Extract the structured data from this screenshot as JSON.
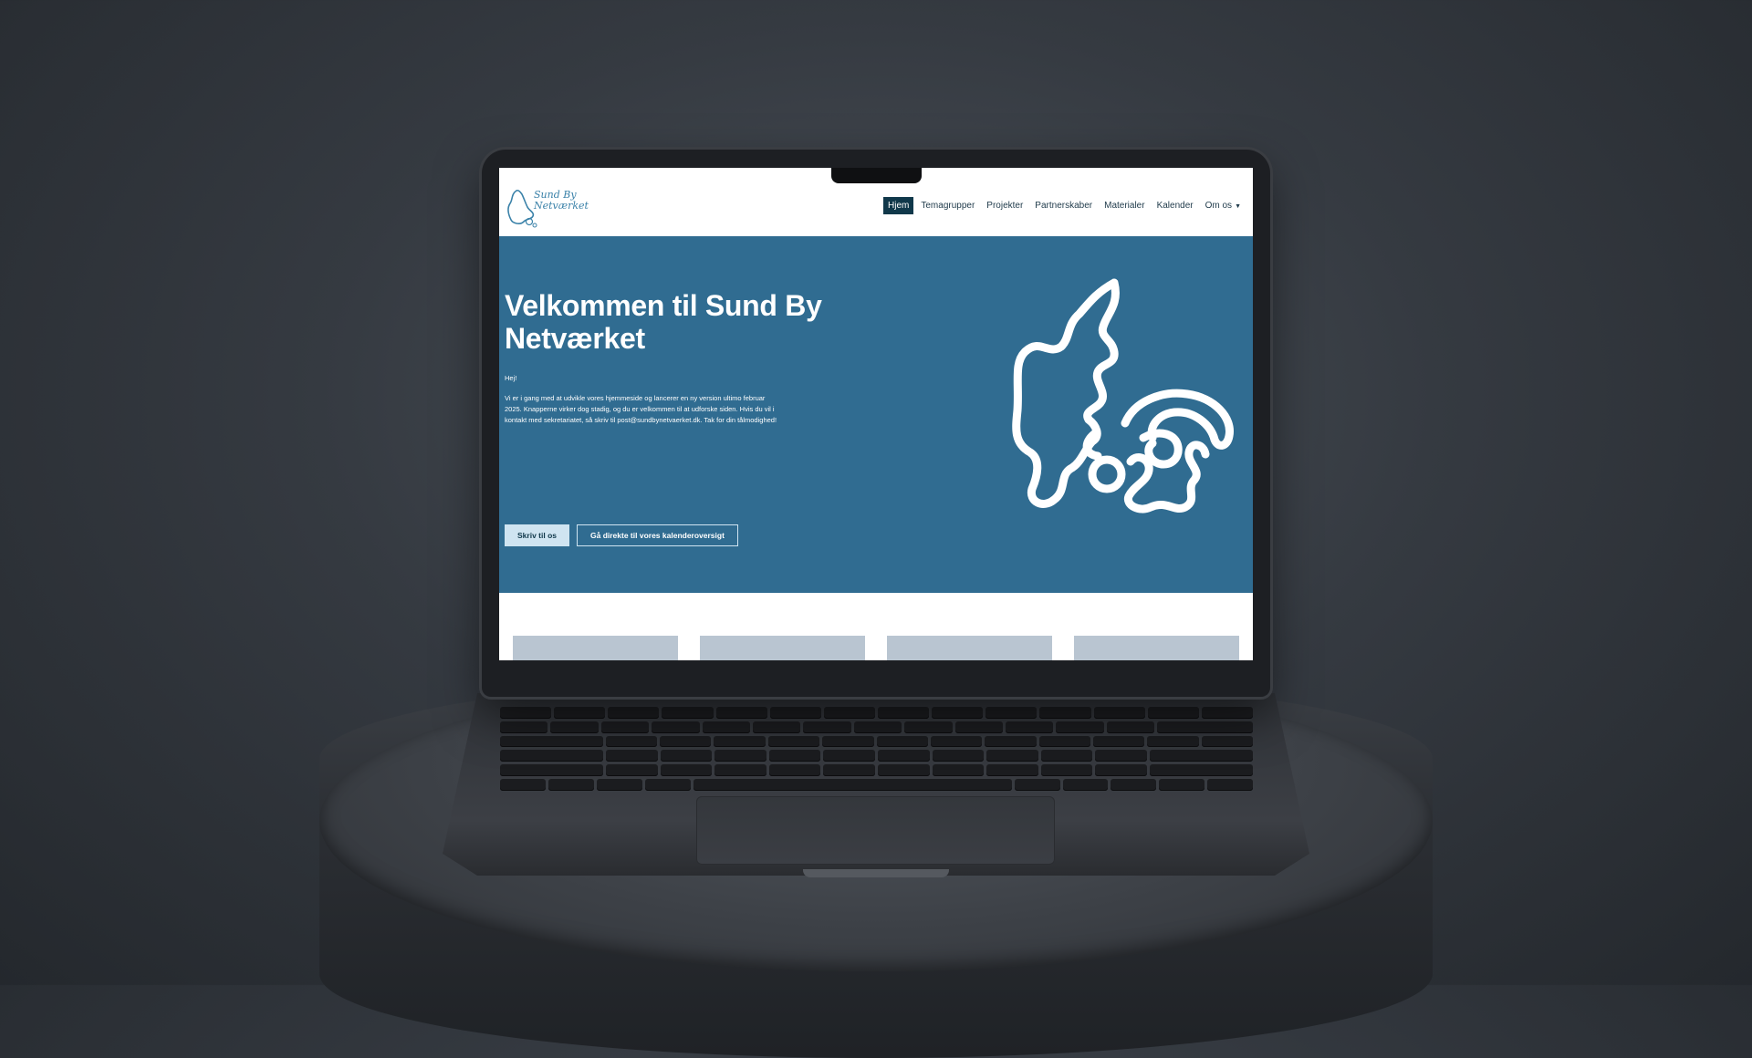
{
  "site": {
    "logo_line1": "Sund By",
    "logo_line2": "Netværket",
    "nav": [
      {
        "label": "Hjem",
        "active": true
      },
      {
        "label": "Temagrupper",
        "active": false
      },
      {
        "label": "Projekter",
        "active": false
      },
      {
        "label": "Partnerskaber",
        "active": false
      },
      {
        "label": "Materialer",
        "active": false
      },
      {
        "label": "Kalender",
        "active": false
      },
      {
        "label": "Om os",
        "active": false,
        "dropdown": true
      }
    ],
    "hero": {
      "title": "Velkommen til Sund By Netværket",
      "greeting": "Hej!",
      "body": "Vi er i gang med at udvikle vores hjemmeside og lancerer en ny version ultimo februar 2025. Knapperne virker dog stadig, og du er velkommen til at udforske siden. Hvis du vil i kontakt med sekretariatet, så skriv til post@sundbynetvaerket.dk. Tak for din tålmodighed!",
      "primary_button": "Skriv til os",
      "secondary_button": "Gå direkte til vores kalenderoversigt",
      "art_icon": "denmark-map-outline-icon"
    },
    "cards_count": 4
  },
  "colors": {
    "hero_bg": "#306c91",
    "nav_active_bg": "#10384a",
    "button_primary_bg": "#cfe4f1",
    "card_placeholder": "#b9c5d1",
    "logo_blue": "#3b82a9"
  }
}
